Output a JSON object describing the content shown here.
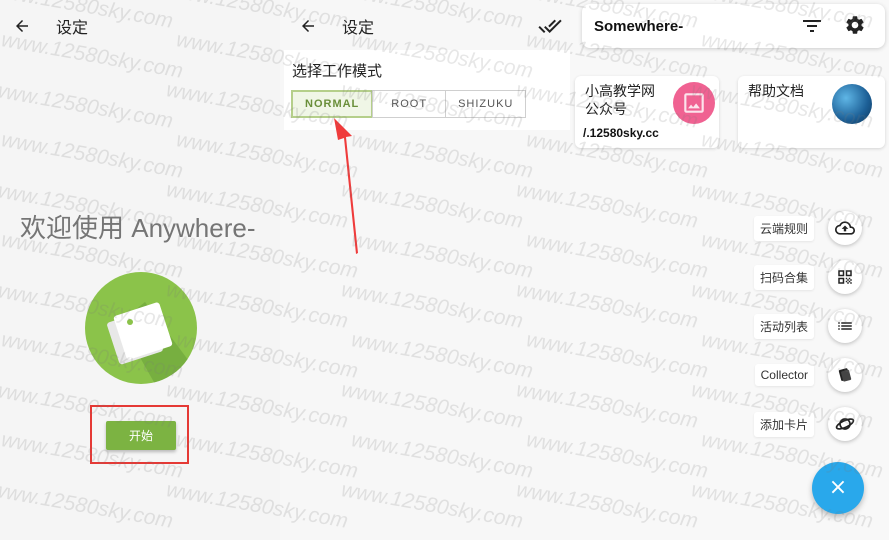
{
  "panel_welcome": {
    "title": "设定",
    "welcome_text": "欢迎使用 Anywhere-",
    "start_button": "开始",
    "icons": {
      "back": "arrow-back-icon",
      "logo": "anywhere-logo"
    }
  },
  "panel_settings": {
    "title": "设定",
    "mode_title": "选择工作模式",
    "modes": [
      "NORMAL",
      "ROOT",
      "SHIZUKU"
    ],
    "selected_mode": "NORMAL",
    "icons": {
      "back": "arrow-back-icon",
      "confirm": "double-check-icon"
    }
  },
  "panel_main": {
    "app_title": "Somewhere-",
    "cards": [
      {
        "title_line1": "小高教学网",
        "title_line2": "公众号",
        "subtitle": "/.12580sky.cc",
        "icon": "image-icon"
      },
      {
        "title_line1": "帮助文档",
        "title_line2": "",
        "subtitle": "",
        "icon": "globe-icon"
      }
    ],
    "fab_items": [
      {
        "label": "云端规则",
        "icon": "cloud-upload-icon"
      },
      {
        "label": "扫码合集",
        "icon": "qr-code-icon"
      },
      {
        "label": "活动列表",
        "icon": "list-icon"
      },
      {
        "label": "Collector",
        "icon": "collector-icon"
      },
      {
        "label": "添加卡片",
        "icon": "planet-icon"
      }
    ],
    "fab_close_glyph": "×"
  },
  "watermark": "www.12580sky.com",
  "colors": {
    "accent_green": "#8bc34a",
    "button_green": "#7cb342",
    "highlight_red": "#e53935",
    "fab_blue": "#29a8eb",
    "card_pink": "#f06292"
  }
}
